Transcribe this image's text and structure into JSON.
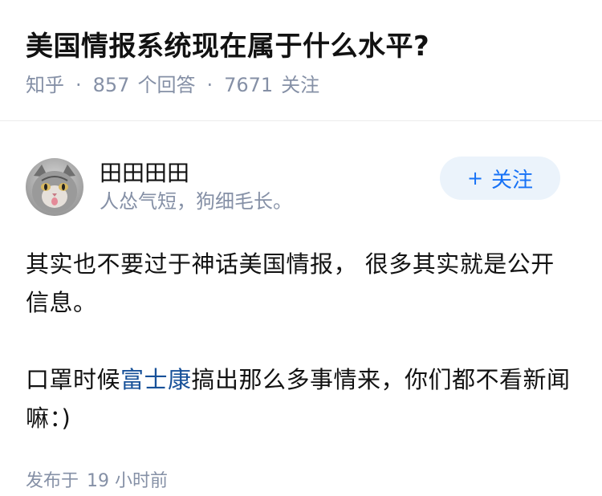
{
  "question": {
    "title": "美国情报系统现在属于什么水平?",
    "source": "知乎",
    "answer_count": "857",
    "answer_label": "个回答",
    "follower_count": "7671",
    "follower_label": "关注"
  },
  "author": {
    "name": "田田田田",
    "bio": "人怂气短，狗细毛长。",
    "follow_label": "关注",
    "follow_icon": "plus-icon"
  },
  "answer": {
    "p1": "其实也不要过于神话美国情报， 很多其实就是公开信息。",
    "p2_before": "口罩时候",
    "p2_link": "富士康",
    "p2_after": "搞出那么多事情来，你们都不看新闻嘛：)",
    "published_label": "发布于",
    "published_time": "19 小时前"
  },
  "colors": {
    "accent": "#1772f6",
    "link": "#175199",
    "muted": "#8590a6"
  }
}
